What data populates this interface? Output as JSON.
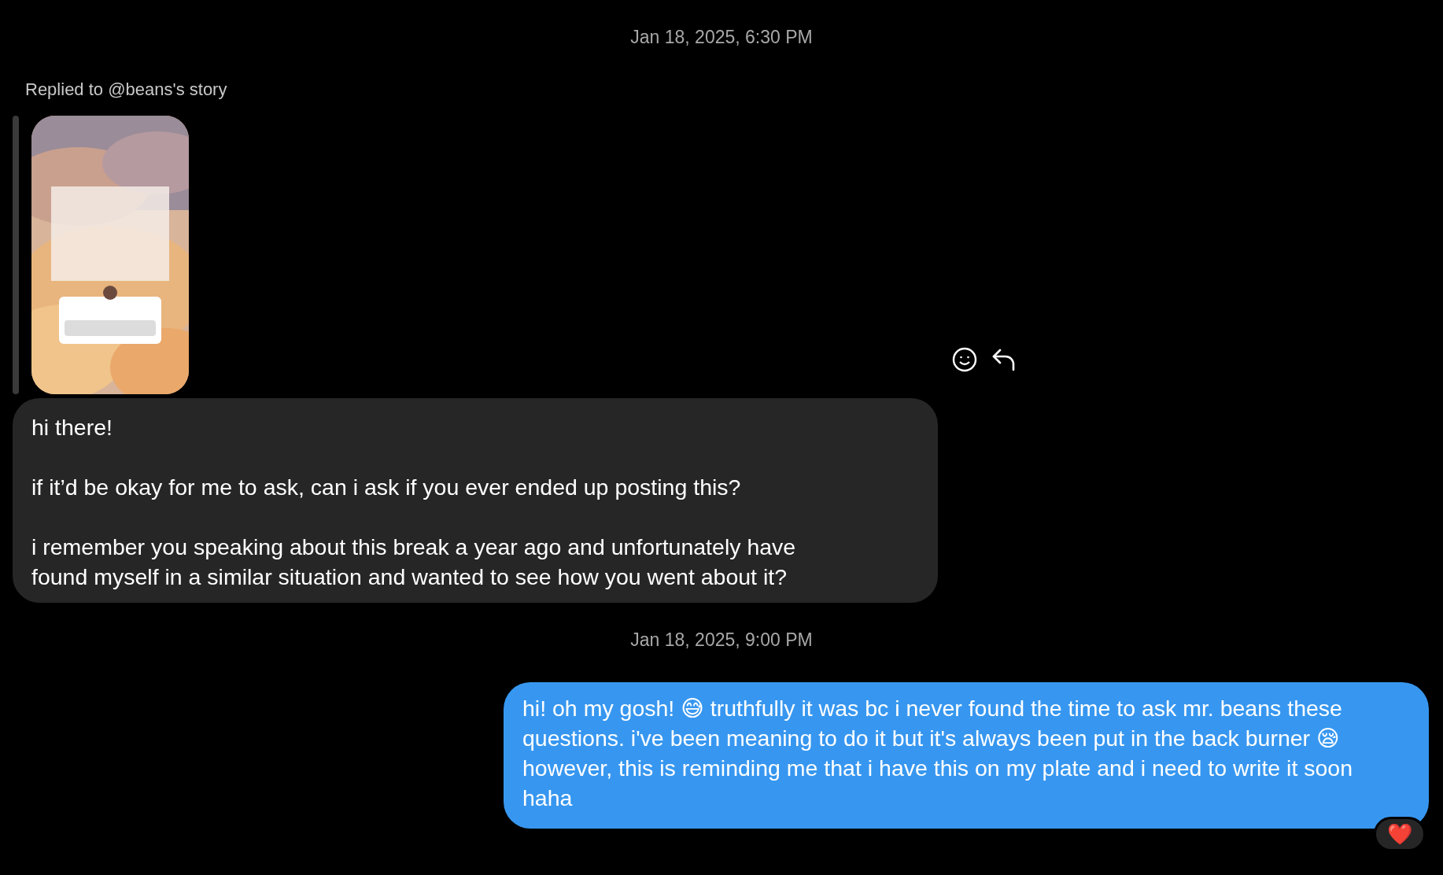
{
  "conversation": [
    {
      "kind": "timestamp",
      "text": "Jan 18, 2025, 6:30 PM"
    },
    {
      "kind": "story_reply",
      "reply_label": "Replied to @beans's story",
      "story": {
        "kind": "picture"
      },
      "paragraphs": [
        "hi there!",
        "if it’d be okay for me to ask, can i ask if you ever ended up posting this?",
        "i remember you speaking about this break a year ago and unfortunately have found myself in a similar situation and wanted to see how you went about it?"
      ]
    },
    {
      "kind": "timestamp",
      "text": "Jan 18, 2025, 9:00 PM"
    },
    {
      "kind": "sent",
      "text": "hi! oh my gosh! 😅 truthfully it was bc i never found the time to ask mr. beans these questions. i've been meaning to do it but it's always been put in the back burner 😪 however, this is reminding me that i have this on my plate and i need to write it soon haha",
      "reaction": "❤️"
    }
  ]
}
